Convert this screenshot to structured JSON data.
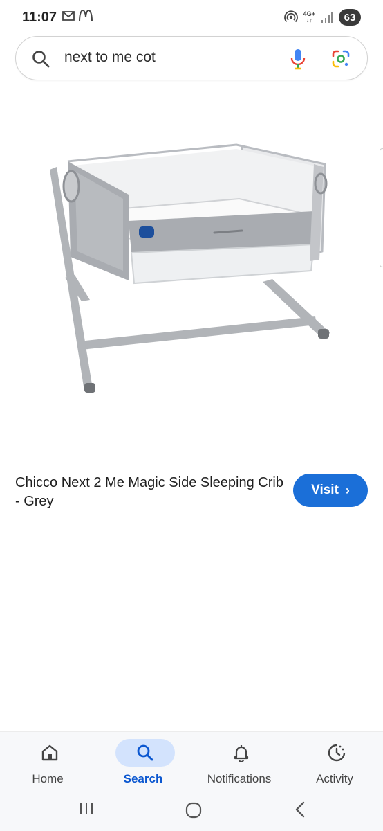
{
  "status_bar": {
    "time": "11:07",
    "notification_icons": [
      "gmail-icon",
      "mcdonalds-icon"
    ],
    "network_label_top": "4G+",
    "network_label_bottom": "↓↑",
    "battery_level": "63"
  },
  "search": {
    "query": "next to me cot"
  },
  "result": {
    "image": "baby-crib-product-image",
    "title": "Chicco Next 2 Me Magic Side Sleeping Crib - Grey",
    "visit_label": "Visit",
    "visit_chevron": "›"
  },
  "bottom_nav": {
    "items": [
      {
        "label": "Home",
        "icon": "home-icon",
        "active": false
      },
      {
        "label": "Search",
        "icon": "search-icon",
        "active": true
      },
      {
        "label": "Notifications",
        "icon": "bell-icon",
        "active": false
      },
      {
        "label": "Activity",
        "icon": "activity-icon",
        "active": false
      }
    ]
  },
  "system_nav": {
    "buttons": [
      "recent-apps-icon",
      "home-button-icon",
      "back-icon"
    ]
  },
  "colors": {
    "accent": "#1b6fd8",
    "nav_active": "#0b57d0",
    "nav_pill": "#d3e3fd"
  }
}
